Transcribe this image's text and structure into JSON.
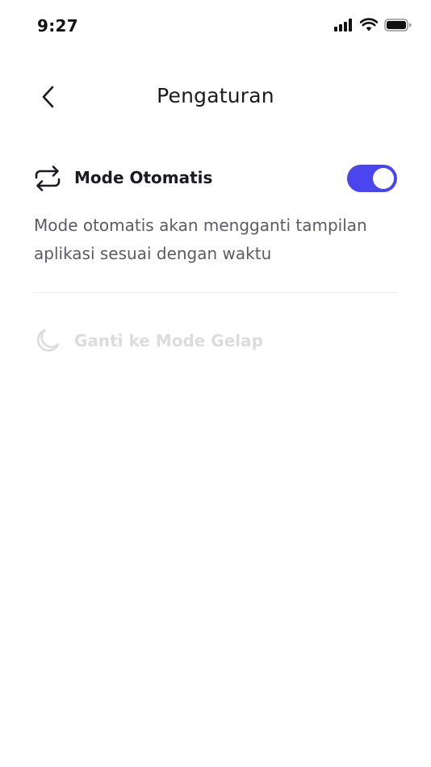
{
  "status_bar": {
    "time": "9:27"
  },
  "header": {
    "title": "Pengaturan",
    "back_icon": "chevron-left-icon"
  },
  "auto_mode": {
    "label": "Mode Otomatis",
    "icon": "repeat-icon",
    "enabled": true,
    "description": "Mode otomatis akan mengganti tampilan aplikasi sesuai dengan waktu"
  },
  "dark_mode": {
    "label": "Ganti ke Mode Gelap",
    "icon": "moon-icon",
    "disabled": true
  },
  "colors": {
    "accent": "#4b45ee",
    "text_primary": "#1b1b21",
    "text_secondary": "#5b5b63",
    "text_disabled": "#dcdcdf",
    "divider": "#ececef"
  }
}
